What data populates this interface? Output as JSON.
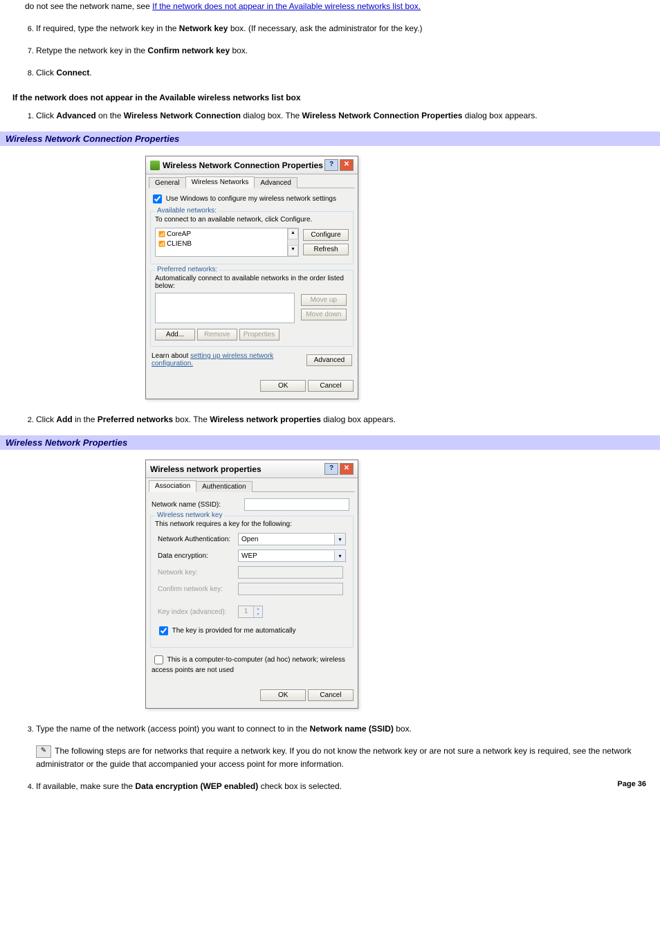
{
  "intro_ol": {
    "partial_text": "do not see the network name, see ",
    "partial_link": "If the network does not appear in the Available wireless networks list box.",
    "step6_a": "If required, type the network key in the ",
    "step6_b": "Network key",
    "step6_c": " box. (If necessary, ask the administrator for the key.)",
    "step7_a": "Retype the network key in the ",
    "step7_b": "Confirm network key",
    "step7_c": " box.",
    "step8_a": "Click ",
    "step8_b": "Connect",
    "step8_c": "."
  },
  "heading_noappear": "If the network does not appear in the Available wireless networks list box",
  "noappear_ol": {
    "s1_a": "Click ",
    "s1_b": "Advanced",
    "s1_c": " on the ",
    "s1_d": "Wireless Network Connection",
    "s1_e": " dialog box. The ",
    "s1_f": "Wireless Network Connection Properties",
    "s1_g": " dialog box appears.",
    "s2_a": "Click ",
    "s2_b": "Add",
    "s2_c": " in the ",
    "s2_d": "Preferred networks",
    "s2_e": " box. The ",
    "s2_f": "Wireless network properties",
    "s2_g": " dialog box appears.",
    "s3_a": "Type the name of the network (access point) you want to connect to in the ",
    "s3_b": "Network name (SSID)",
    "s3_c": " box.",
    "s4_a": "If available, make sure the ",
    "s4_b": "Data encryption (WEP enabled)",
    "s4_c": " check box is selected."
  },
  "caption1": "Wireless Network Connection Properties",
  "caption2": "Wireless Network Properties",
  "dlg1": {
    "title": "Wireless Network Connection Properties",
    "tabs": [
      "General",
      "Wireless Networks",
      "Advanced"
    ],
    "use_windows": "Use Windows to configure my wireless network settings",
    "avail_legend": "Available networks:",
    "avail_text": "To connect to an available network, click Configure.",
    "avail_items": [
      "CoreAP",
      "CLIENB"
    ],
    "btn_configure": "Configure",
    "btn_refresh": "Refresh",
    "pref_legend": "Preferred networks:",
    "pref_text": "Automatically connect to available networks in the order listed below:",
    "btn_moveup": "Move up",
    "btn_movedown": "Move down",
    "btn_add": "Add...",
    "btn_remove": "Remove",
    "btn_props": "Properties",
    "learn_a": "Learn about ",
    "learn_link": "setting up wireless network configuration.",
    "btn_adv": "Advanced",
    "btn_ok": "OK",
    "btn_cancel": "Cancel"
  },
  "dlg2": {
    "title": "Wireless network properties",
    "tabs": [
      "Association",
      "Authentication"
    ],
    "ssid_label": "Network name (SSID):",
    "wk_legend": "Wireless network key",
    "wk_text": "This network requires a key for the following:",
    "auth_label": "Network Authentication:",
    "auth_val": "Open",
    "enc_label": "Data encryption:",
    "enc_val": "WEP",
    "netkey_label": "Network key:",
    "confirm_label": "Confirm network key:",
    "keyidx_label": "Key index (advanced):",
    "keyidx_val": "1",
    "auto_key": "The key is provided for me automatically",
    "adhoc": "This is a computer-to-computer (ad hoc) network; wireless access points are not used",
    "btn_ok": "OK",
    "btn_cancel": "Cancel"
  },
  "note": "The following steps are for networks that require a network key. If you do not know the network key or are not sure a network key is required, see the network administrator or the guide that accompanied your access point for more information.",
  "page_num": "Page 36"
}
